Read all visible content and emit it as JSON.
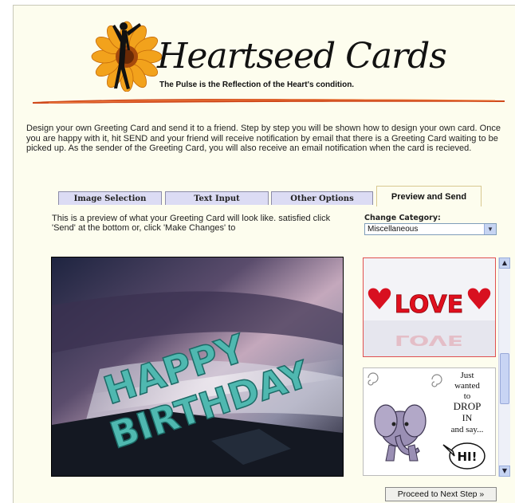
{
  "header": {
    "logo_text": "Heartseed Cards",
    "tagline": "The Pulse is the Reflection of the Heart's condition."
  },
  "intro": "Design your own Greeting Card and send it to a friend. Step by step you will be shown how to design your own card. Once you are happy with it, hit SEND and your friend will receive notification by email that there is a Greeting Card waiting to be picked up. As the sender of the Greeting Card, you will also receive an email notification when the card is recieved.",
  "tabs": [
    {
      "label": "Image Selection"
    },
    {
      "label": "Text Input"
    },
    {
      "label": "Other Options"
    },
    {
      "label": "Preview and Send"
    }
  ],
  "preview_instructions": "This is a preview of what your Greeting Card will look like. satisfied click 'Send' at the bottom or, click 'Make Changes' to",
  "category": {
    "label": "Change Category:",
    "selected": "Miscellaneous"
  },
  "preview_card": {
    "text_line1": "HAPPY",
    "text_line2": "BIRTHDAY"
  },
  "thumbnails": [
    {
      "text": "LOVE"
    },
    {
      "text_lines": [
        "Just",
        "wanted",
        "to",
        "DROP",
        "IN",
        "and say..."
      ],
      "bubble": "HI!"
    }
  ],
  "proceed_button": "Proceed to Next Step »",
  "colors": {
    "page_bg": "#fdfdee",
    "tab_bg": "#dcdcf4",
    "love_red": "#e0101e",
    "card_teal": "#4fb8b0"
  },
  "icons": {
    "scroll_up": "chevron-up-icon",
    "scroll_down": "chevron-down-icon",
    "dropdown": "chevron-down-icon"
  }
}
